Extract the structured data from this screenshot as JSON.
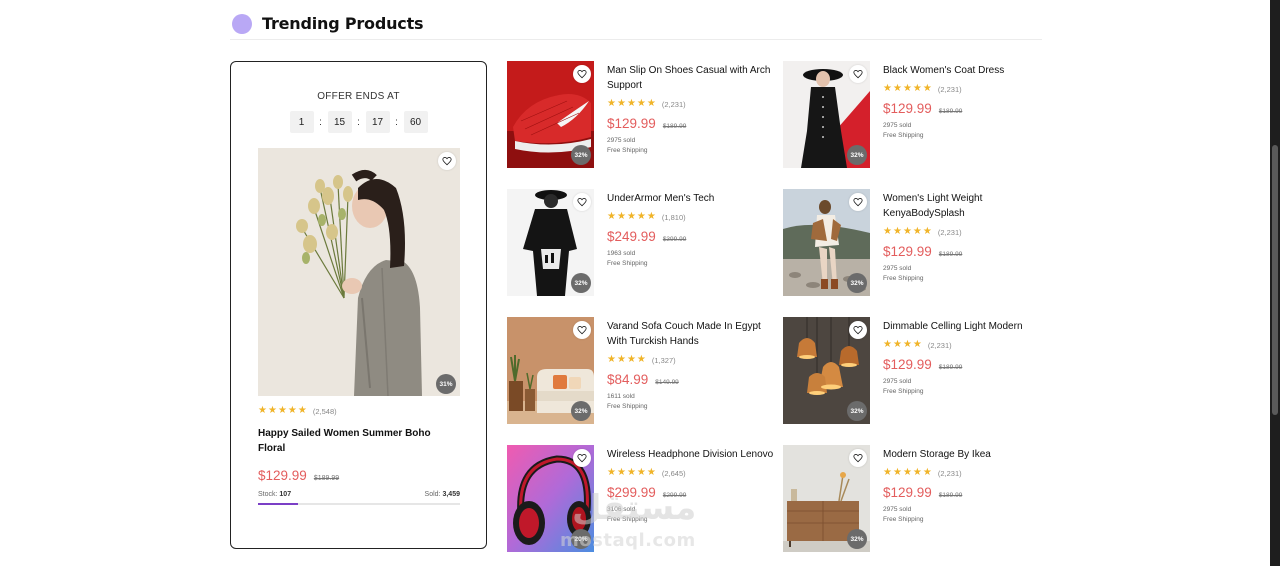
{
  "section": {
    "title": "Trending Products",
    "accent_color": "#b9a8f5"
  },
  "offer": {
    "label": "OFFER ENDS AT",
    "countdown": [
      "1",
      "15",
      "17",
      "60"
    ],
    "separator": ":",
    "image_icon": "woman-with-flowers-photo",
    "discount": "31%",
    "rating_count": "(2,548)",
    "name": "Happy Sailed Women Summer Boho Floral",
    "price": "$129.99",
    "old_price": "$189.99",
    "stock_label": "Stock:",
    "stock_value": "107",
    "sold_label": "Sold:",
    "sold_value": "3,459",
    "progress_fraction": 0.2
  },
  "products": [
    {
      "name": "Man Slip On Shoes Casual with Arch Support",
      "rating_count": "(2,231)",
      "price": "$129.99",
      "old_price": "$189.99",
      "sold": "2975 sold",
      "shipping": "Free Shipping",
      "discount": "32%",
      "image_icon": "red-sneaker-photo"
    },
    {
      "name": "Black Women's Coat Dress",
      "rating_count": "(2,231)",
      "price": "$129.99",
      "old_price": "$189.99",
      "sold": "2975 sold",
      "shipping": "Free Shipping",
      "discount": "32%",
      "image_icon": "black-coat-dress-photo"
    },
    {
      "name": "UnderArmor Men's Tech",
      "rating_count": "(1,810)",
      "price": "$249.99",
      "old_price": "$399.99",
      "sold": "1963 sold",
      "shipping": "Free Shipping",
      "discount": "32%",
      "image_icon": "black-outfit-photo"
    },
    {
      "name": "Women's Light Weight KenyaBodySplash",
      "rating_count": "(2,231)",
      "price": "$129.99",
      "old_price": "$189.99",
      "sold": "2975 sold",
      "shipping": "Free Shipping",
      "discount": "32%",
      "image_icon": "woman-beach-photo"
    },
    {
      "name": "Varand Sofa Couch Made In Egypt With Turckish Hands",
      "rating_count": "(1,327)",
      "price": "$84.99",
      "old_price": "$149.99",
      "sold": "1611 sold",
      "shipping": "Free Shipping",
      "discount": "32%",
      "image_icon": "sofa-room-photo"
    },
    {
      "name": "Dimmable Celling Light Modern",
      "rating_count": "(2,231)",
      "price": "$129.99",
      "old_price": "$189.99",
      "sold": "2975 sold",
      "shipping": "Free Shipping",
      "discount": "32%",
      "image_icon": "copper-pendant-lights-photo"
    },
    {
      "name": "Wireless Headphone Division Lenovo",
      "rating_count": "(2,645)",
      "price": "$299.99",
      "old_price": "$299.99",
      "sold": "3106 sold",
      "shipping": "Free Shipping",
      "discount": "20%",
      "image_icon": "red-headphones-photo"
    },
    {
      "name": "Modern Storage By Ikea",
      "rating_count": "(2,231)",
      "price": "$129.99",
      "old_price": "$189.99",
      "sold": "2975 sold",
      "shipping": "Free Shipping",
      "discount": "32%",
      "image_icon": "wooden-dresser-photo"
    }
  ],
  "watermark": {
    "text": "مستقل",
    "sub": "mostaql.com"
  },
  "colors": {
    "price": "#e35d5d",
    "star": "#f0b429",
    "progress": "#7b3fc6"
  }
}
